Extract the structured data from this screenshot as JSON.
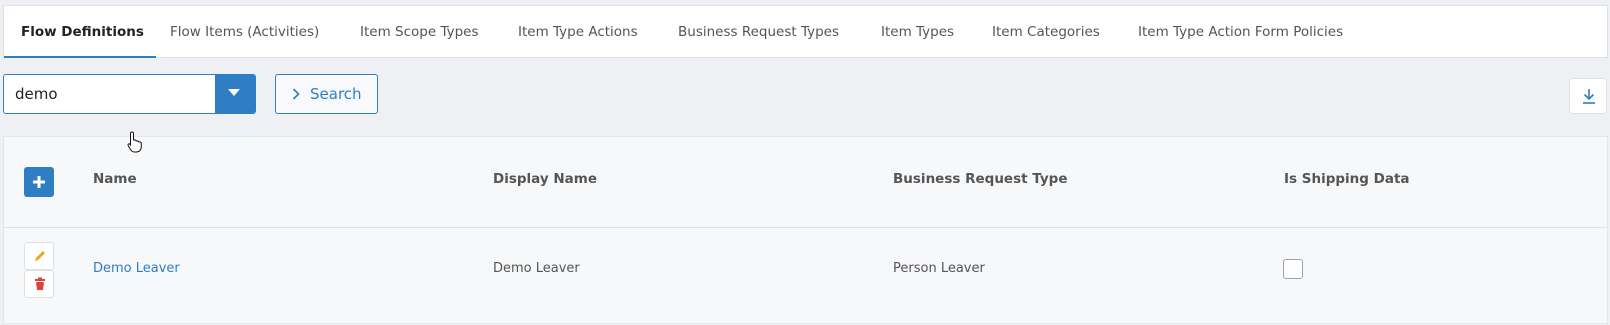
{
  "tabs": [
    {
      "label": "Flow Definitions",
      "active": true
    },
    {
      "label": "Flow Items (Activities)"
    },
    {
      "label": "Item Scope Types"
    },
    {
      "label": "Item Type Actions"
    },
    {
      "label": "Business Request Types"
    },
    {
      "label": "Item Types"
    },
    {
      "label": "Item Categories"
    },
    {
      "label": "Item Type Action Form Policies"
    }
  ],
  "toolbar": {
    "filter_value": "demo",
    "search_label": "Search",
    "download_icon": "download-icon"
  },
  "grid": {
    "columns": [
      "Name",
      "Display Name",
      "Business Request Type",
      "Is Shipping Data"
    ],
    "rows": [
      {
        "name": "Demo Leaver",
        "display_name": "Demo Leaver",
        "business_request_type": "Person Leaver",
        "is_shipping_data": false
      }
    ]
  },
  "colors": {
    "accent": "#2f7ec3",
    "edit_icon": "#f0a30a",
    "delete_icon": "#e0403a"
  }
}
